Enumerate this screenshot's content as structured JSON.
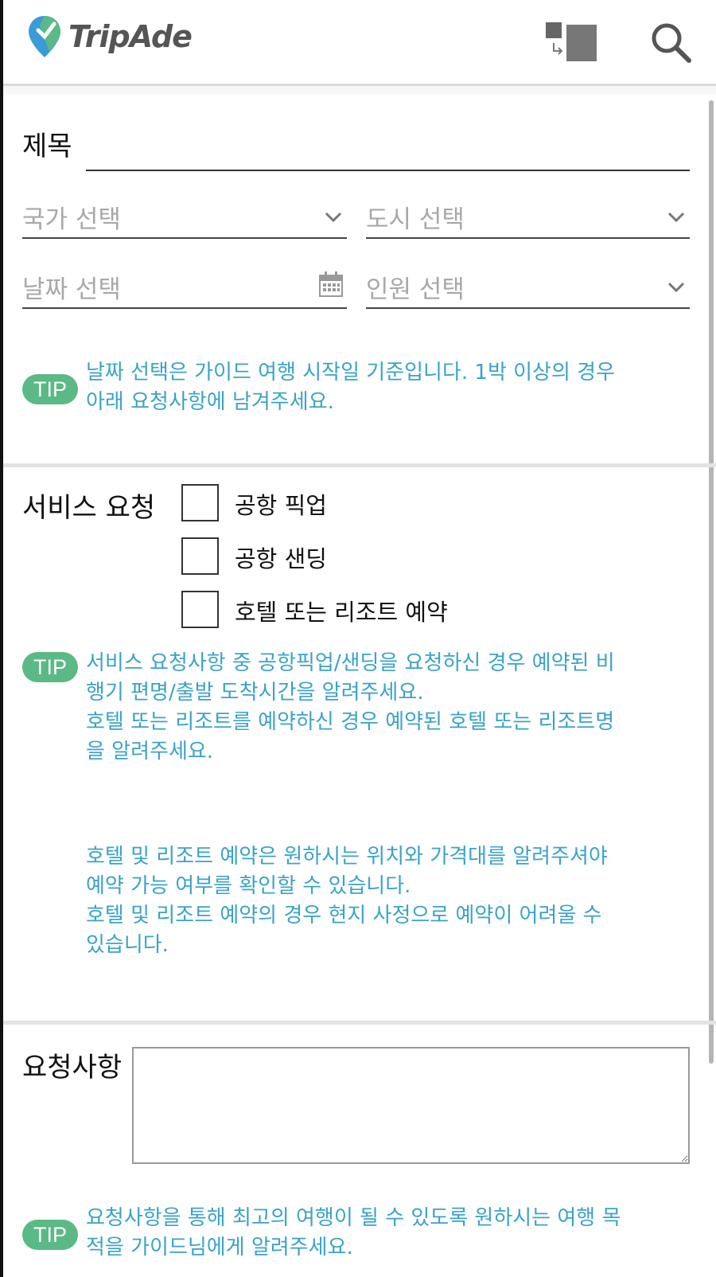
{
  "header": {
    "logo_text": "TripAde",
    "brand_colors": {
      "blue": "#3a9bd6",
      "green": "#5bb986",
      "text": "#555555"
    },
    "icons": [
      "translate-icon",
      "search-icon"
    ]
  },
  "trip_form": {
    "title_label": "제목",
    "title_value": "",
    "country_placeholder": "국가 선택",
    "city_placeholder": "도시 선택",
    "date_placeholder": "날짜 선택",
    "people_placeholder": "인원 선택",
    "tip_badge": "TIP",
    "tip_text": "날짜 선택은 가이드 여행 시작일 기준입니다. 1박 이상의 경우\n아래 요청사항에 남겨주세요."
  },
  "services": {
    "label": "서비스 요청",
    "options": [
      {
        "label": "공항 픽업",
        "checked": false
      },
      {
        "label": "공항 샌딩",
        "checked": false
      },
      {
        "label": "호텔 또는 리조트 예약",
        "checked": false
      }
    ],
    "tip_badge": "TIP",
    "tip_text": "서비스 요청사항 중 공항픽업/샌딩을 요청하신 경우 예약된 비\n행기 편명/출발 도착시간을 알려주세요.\n호텔 또는 리조트를 예약하신 경우 예약된 호텔 또는 리조트명\n을 알려주세요.",
    "note_text": "호텔 및 리조트 예약은 원하시는 위치와 가격대를 알려주셔야\n예약 가능 여부를 확인할 수 있습니다.\n호텔 및 리조트 예약의 경우 현지 사정으로 예약이 어려울 수\n있습니다."
  },
  "requests": {
    "label": "요청사항",
    "value": "",
    "tip_badge": "TIP",
    "tip_text": "요청사항을 통해 최고의 여행이 될 수 있도록 원하시는 여행 목\n적을 가이드님에게 알려주세요."
  },
  "colors": {
    "tip_badge": "#5bb986",
    "tip_text": "#3aa3c8",
    "placeholder": "#a8a8a8",
    "divider": "#e3e3e3"
  }
}
